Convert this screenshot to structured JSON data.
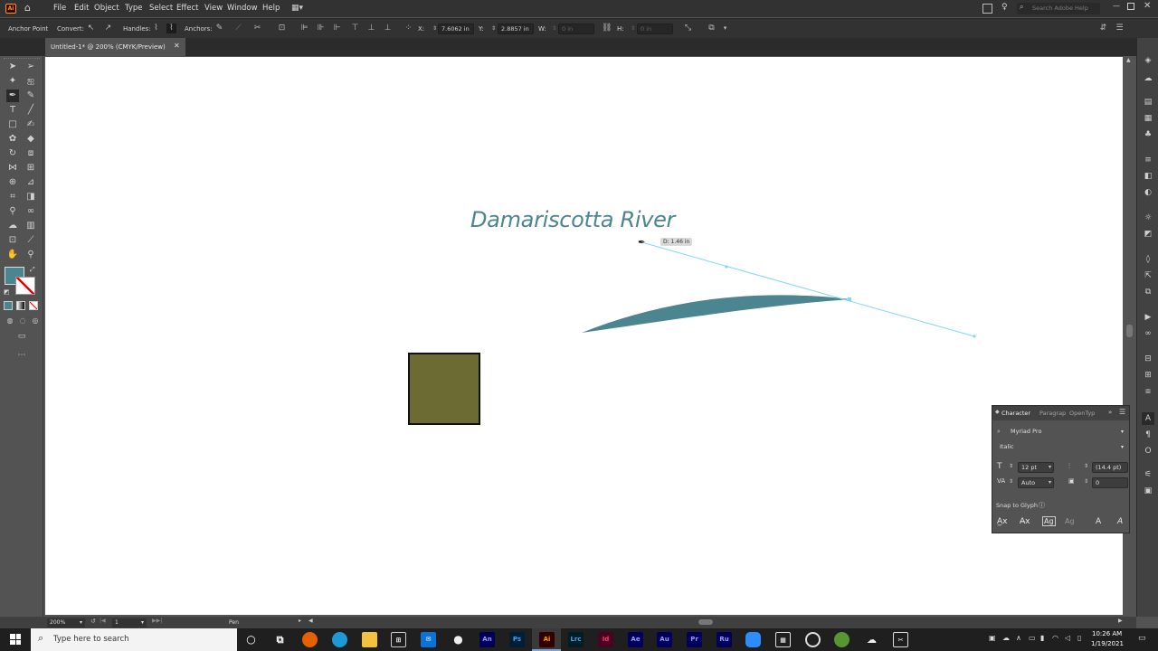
{
  "app": {
    "badge": "Ai",
    "accent": "#ff9a00"
  },
  "menu": [
    "File",
    "Edit",
    "Object",
    "Type",
    "Select",
    "Effect",
    "View",
    "Window",
    "Help"
  ],
  "search": {
    "placeholder": "Search Adobe Help"
  },
  "control_bar": {
    "selection_label": "Anchor Point",
    "convert_label": "Convert:",
    "handles_label": "Handles:",
    "anchors_label": "Anchors:",
    "x_label": "X:",
    "x_value": "7.6062 in",
    "y_label": "Y:",
    "y_value": "2.8857 in",
    "w_label": "W:",
    "w_value": "0 in",
    "h_label": "H:",
    "h_value": "0 in"
  },
  "document": {
    "tab_title": "Untitled-1* @ 200% (CMYK/Preview)"
  },
  "canvas": {
    "text": "Damariscotta River",
    "tooltip": "D: 1.46 in",
    "text_color": "#4a8590",
    "shape_color": "#4a8590",
    "square_color": "#6b6b33",
    "path_color": "#7fd7f5"
  },
  "swatches": {
    "fill": "#4a8590"
  },
  "character_panel": {
    "tabs": [
      "Character",
      "Paragrap",
      "OpenTyp"
    ],
    "font": "Myriad Pro",
    "style": "Italic",
    "size": "12 pt",
    "leading": "(14.4 pt)",
    "kerning": "Auto",
    "tracking": "0",
    "snap_label": "Snap to Glyph"
  },
  "status": {
    "zoom": "200%",
    "artboard": "1",
    "tool": "Pen"
  },
  "taskbar": {
    "search_placeholder": "Type here to search",
    "apps": [
      "An",
      "Ps",
      "Ai",
      "Lrc",
      "Id",
      "Ae",
      "Au",
      "Pr",
      "Ru"
    ],
    "time": "10:26 AM",
    "date": "1/19/2021"
  }
}
